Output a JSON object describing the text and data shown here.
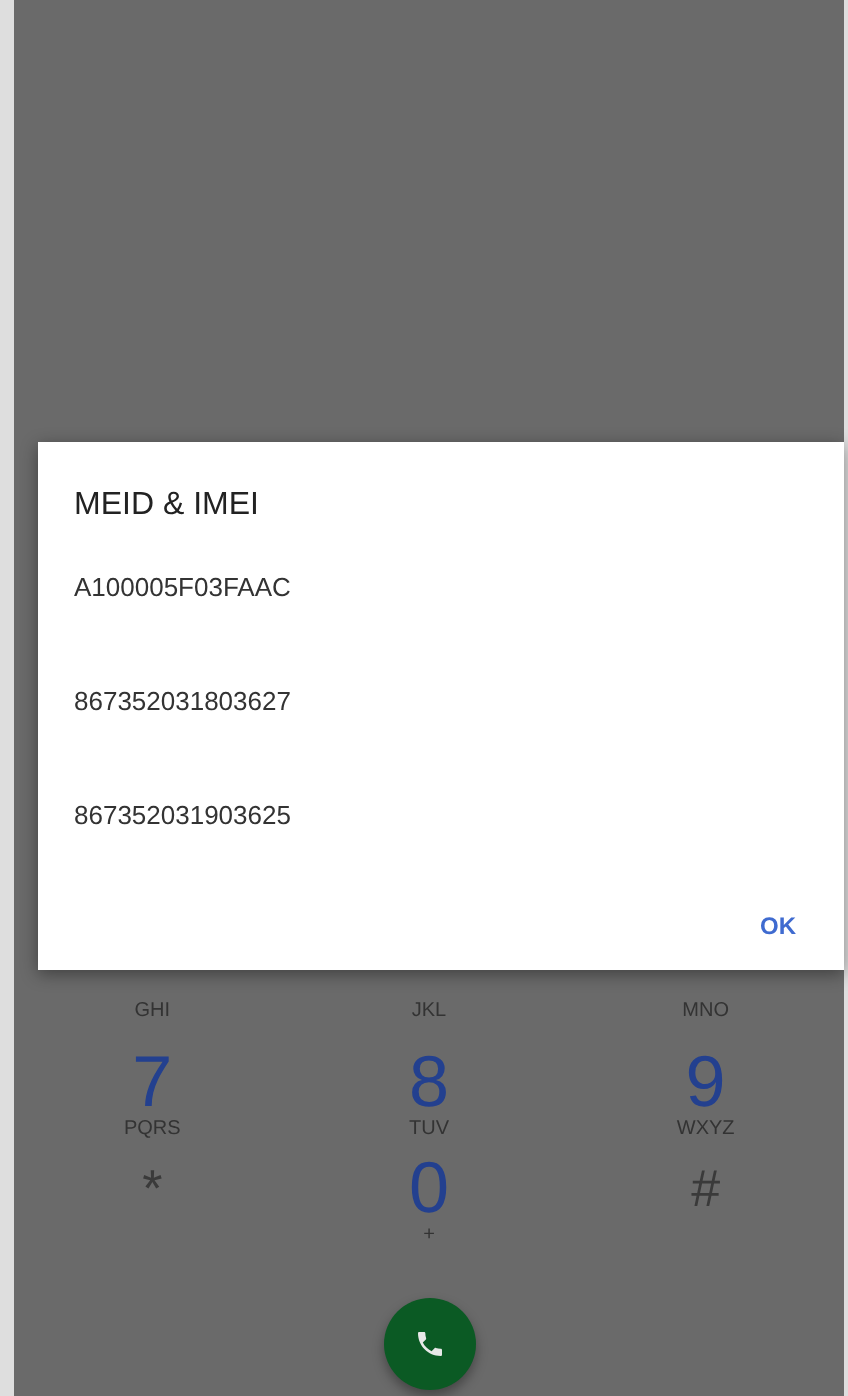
{
  "dialog": {
    "title": "MEID & IMEI",
    "lines": [
      "A100005F03FAAC",
      "867352031803627",
      "867352031903625"
    ],
    "button": "OK"
  },
  "keypad": [
    [
      {
        "letters": "GHI"
      },
      {
        "letters": "JKL"
      },
      {
        "letters": "MNO"
      }
    ],
    [
      {
        "digit": "7",
        "letters": "PQRS"
      },
      {
        "digit": "8",
        "letters": "TUV"
      },
      {
        "digit": "9",
        "letters": "WXYZ"
      }
    ],
    [
      {
        "digit": "*",
        "kind": "symbol"
      },
      {
        "digit": "0",
        "letters": "+"
      },
      {
        "digit": "#",
        "kind": "symbol"
      }
    ]
  ]
}
